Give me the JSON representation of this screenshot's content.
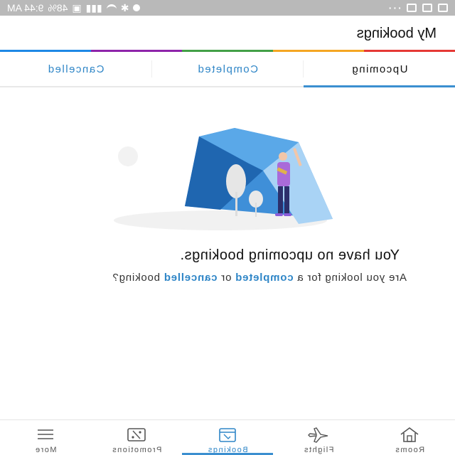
{
  "status_bar": {
    "time": "9:44 AM",
    "battery": "48%"
  },
  "header": {
    "title": "My bookings"
  },
  "brand_stripe": [
    "#e53935",
    "#f5a623",
    "#43a047",
    "#8e24aa",
    "#1e88e5"
  ],
  "tabs": [
    {
      "label": "Upcoming",
      "active": true
    },
    {
      "label": "Completed",
      "active": false
    },
    {
      "label": "Cancelled",
      "active": false
    }
  ],
  "empty_state": {
    "title": "You have no upcoming bookings.",
    "message_prefix": "Are you looking for a ",
    "link_completed": "completed",
    "message_or": " or ",
    "link_cancelled": "cancelled",
    "message_suffix": " booking?"
  },
  "bottom_nav": [
    {
      "label": "Rooms",
      "icon": "house-icon",
      "active": false
    },
    {
      "label": "Flights",
      "icon": "airplane-icon",
      "active": false
    },
    {
      "label": "Bookings",
      "icon": "calendar-icon",
      "active": true
    },
    {
      "label": "Promotions",
      "icon": "tag-icon",
      "active": false
    },
    {
      "label": "More",
      "icon": "menu-icon",
      "active": false
    }
  ],
  "colors": {
    "accent": "#2f86c7",
    "tab_indicator": "#3b8fd0"
  }
}
